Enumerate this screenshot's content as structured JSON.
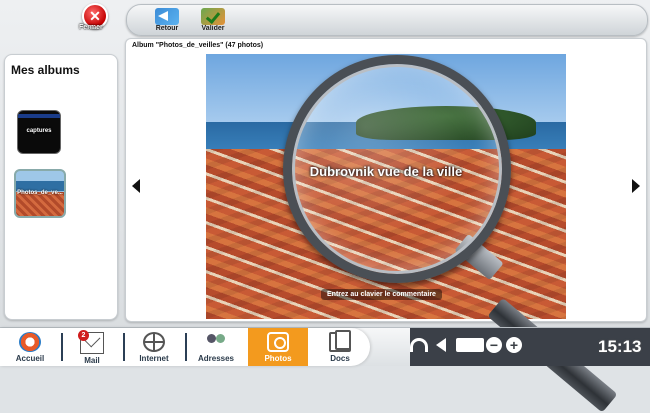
{
  "header": {
    "close_label": "Fermer",
    "back_label": "Retour",
    "validate_label": "Valider"
  },
  "sidebar": {
    "title": "Mes albums",
    "albums": [
      {
        "label": "captures"
      },
      {
        "label": "Photos_de_ve..."
      }
    ]
  },
  "main": {
    "album_title": "Album \"Photos_de_veilles\" (47 photos)",
    "photo_caption": "Dubrovnik vue de la ville",
    "comment_hint": "Entrez au clavier le commentaire"
  },
  "taskbar": {
    "items": [
      {
        "label": "Accueil",
        "icon": "home-icon"
      },
      {
        "label": "Mail",
        "icon": "mail-icon",
        "badge": "2"
      },
      {
        "label": "Internet",
        "icon": "globe-icon"
      },
      {
        "label": "Adresses",
        "icon": "contacts-icon"
      },
      {
        "label": "Photos",
        "icon": "camera-icon",
        "active": true
      },
      {
        "label": "Docs",
        "icon": "documents-icon"
      }
    ],
    "clock": "15:13"
  },
  "colors": {
    "accent": "#f39a1e",
    "close": "#c40000",
    "status_bar": "#3b4048"
  }
}
